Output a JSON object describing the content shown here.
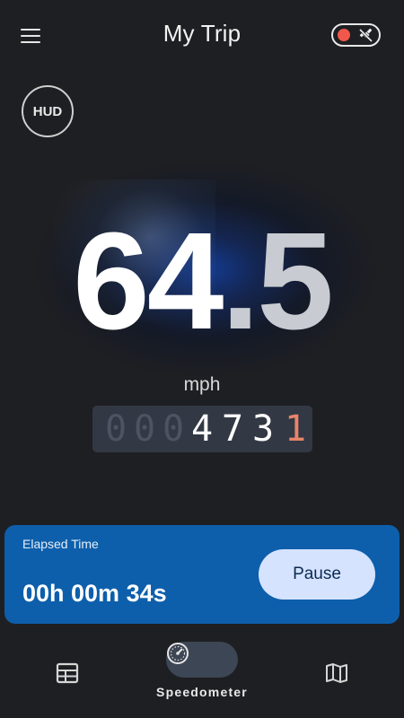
{
  "app_bar": {
    "title": "My Trip",
    "menu_icon": "hamburger-menu-icon",
    "status_icons": [
      "record-dot-icon",
      "satellite-off-icon"
    ]
  },
  "hud": {
    "label": "HUD"
  },
  "speed": {
    "integer_part": "64",
    "decimal_part": ".5",
    "unit": "mph"
  },
  "odometer": {
    "inactive_digits": [
      "0",
      "0",
      "0"
    ],
    "active_digits": [
      "4",
      "7",
      "3"
    ],
    "tenths_digit": "1"
  },
  "elapsed": {
    "label": "Elapsed Time",
    "value": "00h 00m 34s",
    "pause_label": "Pause"
  },
  "nav": {
    "items": [
      {
        "icon": "dashboard-icon",
        "label": ""
      },
      {
        "icon": "speedometer-icon",
        "label": "Speedometer",
        "selected": true
      },
      {
        "icon": "map-icon",
        "label": ""
      }
    ]
  },
  "colors": {
    "background": "#1e1f22",
    "card": "#0d5fab",
    "pause_button": "#d6e3ff",
    "record": "#f2574c",
    "tenths": "#e8846a",
    "nav_pill": "#3d4654"
  }
}
